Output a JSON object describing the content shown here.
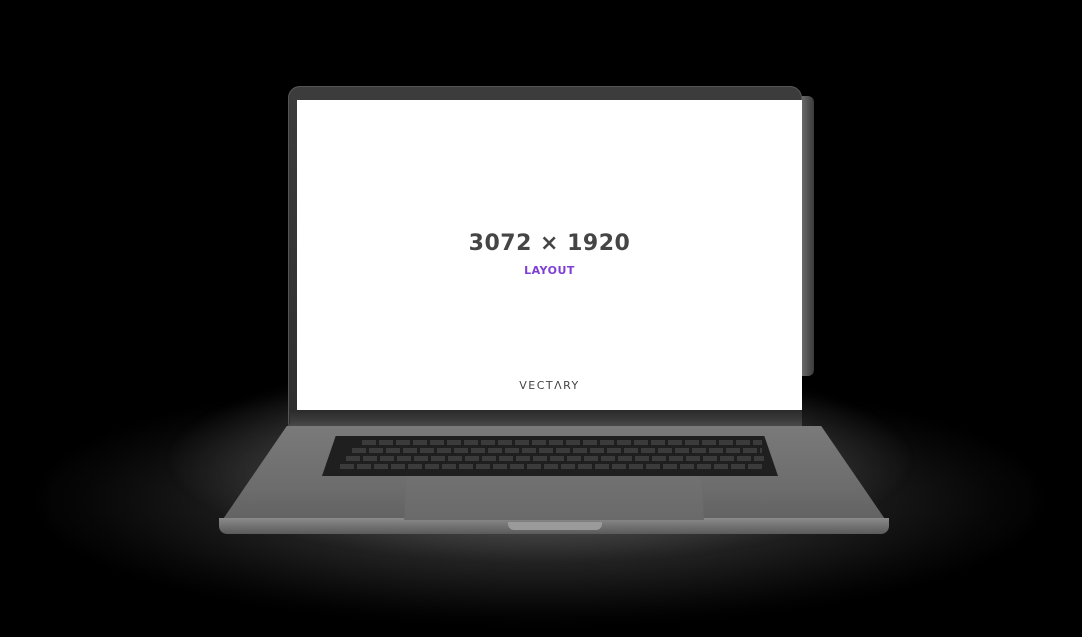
{
  "screen": {
    "resolution": "3072 × 1920",
    "label": "LAYOUT",
    "brand": "VECTΛRY"
  },
  "colors": {
    "background": "#000000",
    "screen": "#ffffff",
    "resolution_text": "#454545",
    "label_accent": "#7d3fd6",
    "laptop_body": "#6e6e6e"
  }
}
